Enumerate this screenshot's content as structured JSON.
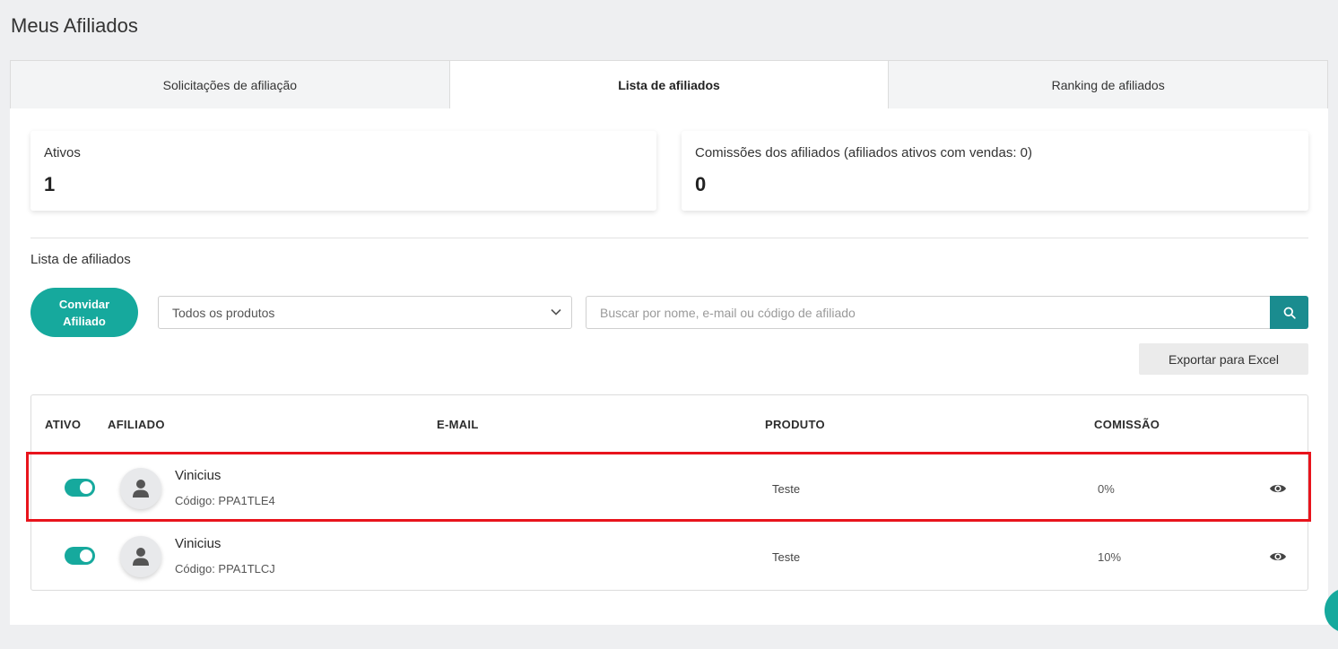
{
  "page": {
    "title": "Meus Afiliados"
  },
  "tabs": [
    {
      "label": "Solicitações de afiliação",
      "active": false
    },
    {
      "label": "Lista de afiliados",
      "active": true
    },
    {
      "label": "Ranking de afiliados",
      "active": false
    }
  ],
  "stats": {
    "active": {
      "label": "Ativos",
      "value": "1"
    },
    "commissions": {
      "label": "Comissões dos afiliados (afiliados ativos com vendas: 0)",
      "value": "0"
    }
  },
  "list": {
    "title": "Lista de afiliados",
    "invite_label": "Convidar\nAfiliado",
    "product_filter": {
      "selected": "Todos os produtos"
    },
    "search": {
      "placeholder": "Buscar por nome, e-mail ou código de afiliado",
      "value": ""
    },
    "export_label": "Exportar para Excel"
  },
  "table": {
    "headers": {
      "active": "ATIVO",
      "affiliate": "AFILIADO",
      "email": "E-MAIL",
      "product": "PRODUTO",
      "commission": "COMISSÃO"
    },
    "rows": [
      {
        "active": true,
        "name": "Vinicius",
        "code": "Código: PPA1TLE4",
        "email": "",
        "product": "Teste",
        "commission": "0%",
        "highlighted": true
      },
      {
        "active": true,
        "name": "Vinicius",
        "code": "Código: PPA1TLCJ",
        "email": "",
        "product": "Teste",
        "commission": "10%",
        "highlighted": false
      }
    ]
  },
  "colors": {
    "accent": "#16a99d",
    "search_button": "#1a8c8f",
    "highlight": "#e8141c",
    "background": "#eeeff1"
  },
  "icons": {
    "select_chevron": "chevron-down-icon",
    "search": "search-icon",
    "avatar": "user-icon",
    "view": "eye-icon"
  }
}
